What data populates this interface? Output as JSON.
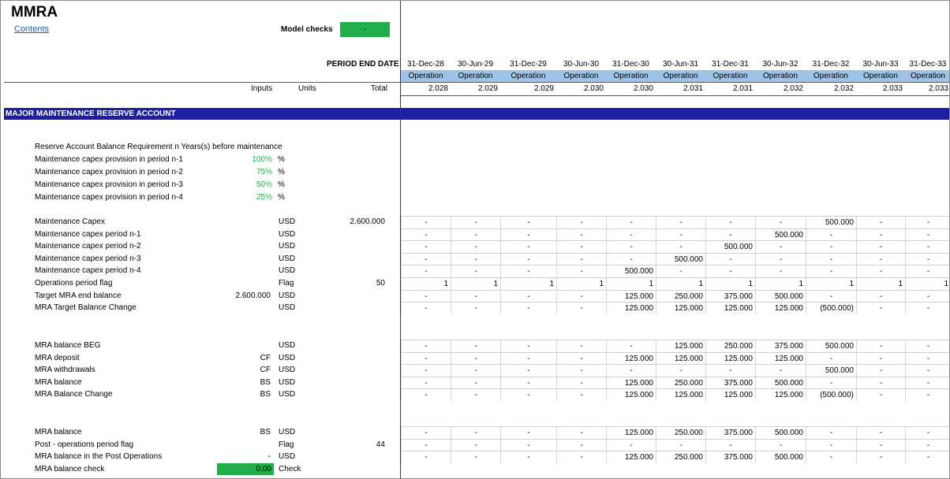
{
  "title": "MMRA",
  "contents_link": "Contents",
  "model_checks": {
    "label": "Model checks",
    "value": "-"
  },
  "period_end_label": "PERIOD END DATE",
  "columns": [
    "31-Dec-28",
    "30-Jun-29",
    "31-Dec-29",
    "30-Jun-30",
    "31-Dec-30",
    "30-Jun-31",
    "31-Dec-31",
    "30-Jun-32",
    "31-Dec-32",
    "30-Jun-33",
    "31-Dec-33"
  ],
  "operation_label": "Operation",
  "years": [
    "2.028",
    "2.029",
    "2.029",
    "2.030",
    "2.030",
    "2.031",
    "2.031",
    "2.032",
    "2.032",
    "2.033",
    "2.033"
  ],
  "header_labels": {
    "inputs": "Inputs",
    "units": "Units",
    "total": "Total"
  },
  "section_title": "MAJOR MAINTENANCE RESERVE ACCOUNT",
  "reserve_header": "Reserve Account Balance Requirement n Years(s) before maintenance",
  "provisions": [
    {
      "label": "Maintenance capex provision in period n-1",
      "value": "100%",
      "unit": "%"
    },
    {
      "label": "Maintenance capex provision in period n-2",
      "value": "75%",
      "unit": "%"
    },
    {
      "label": "Maintenance capex provision in period n-3",
      "value": "50%",
      "unit": "%"
    },
    {
      "label": "Maintenance capex provision in period n-4",
      "value": "25%",
      "unit": "%"
    }
  ],
  "block1": [
    {
      "label": "Maintenance Capex",
      "input": "",
      "unit": "USD",
      "total": "2.600.000",
      "cells": [
        "-",
        "-",
        "-",
        "-",
        "-",
        "-",
        "-",
        "-",
        "500.000",
        "-",
        "-"
      ]
    },
    {
      "label": "Maintenance capex period n-1",
      "input": "",
      "unit": "USD",
      "total": "",
      "cells": [
        "-",
        "-",
        "-",
        "-",
        "-",
        "-",
        "-",
        "500.000",
        "-",
        "-",
        "-"
      ]
    },
    {
      "label": "Maintenance capex period n-2",
      "input": "",
      "unit": "USD",
      "total": "",
      "cells": [
        "-",
        "-",
        "-",
        "-",
        "-",
        "-",
        "500.000",
        "-",
        "-",
        "-",
        "-"
      ]
    },
    {
      "label": "Maintenance capex period n-3",
      "input": "",
      "unit": "USD",
      "total": "",
      "cells": [
        "-",
        "-",
        "-",
        "-",
        "-",
        "500.000",
        "-",
        "-",
        "-",
        "-",
        "-"
      ]
    },
    {
      "label": "Maintenance capex period n-4",
      "input": "",
      "unit": "USD",
      "total": "",
      "cells": [
        "-",
        "-",
        "-",
        "-",
        "500.000",
        "-",
        "-",
        "-",
        "-",
        "-",
        "-"
      ]
    },
    {
      "label": "Operations period flag",
      "input": "",
      "unit": "Flag",
      "total": "50",
      "cells": [
        "1",
        "1",
        "1",
        "1",
        "1",
        "1",
        "1",
        "1",
        "1",
        "1",
        "1"
      ]
    },
    {
      "label": "Target MRA end balance",
      "input": "2.600.000",
      "unit": "USD",
      "total": "",
      "cells": [
        "-",
        "-",
        "-",
        "-",
        "125.000",
        "250.000",
        "375.000",
        "500.000",
        "-",
        "-",
        "-"
      ]
    },
    {
      "label": "MRA Target Balance Change",
      "input": "",
      "unit": "USD",
      "total": "",
      "cells": [
        "-",
        "-",
        "-",
        "-",
        "125.000",
        "125.000",
        "125.000",
        "125.000",
        "(500.000)",
        "-",
        "-"
      ]
    }
  ],
  "block2": [
    {
      "label": "MRA balance BEG",
      "input": "",
      "unit": "USD",
      "total": "",
      "cells": [
        "-",
        "-",
        "-",
        "-",
        "-",
        "125.000",
        "250.000",
        "375.000",
        "500.000",
        "-",
        "-"
      ]
    },
    {
      "label": "MRA deposit",
      "input": "CF",
      "unit": "USD",
      "total": "",
      "cells": [
        "-",
        "-",
        "-",
        "-",
        "125.000",
        "125.000",
        "125.000",
        "125.000",
        "-",
        "-",
        "-"
      ]
    },
    {
      "label": "MRA withdrawals",
      "input": "CF",
      "unit": "USD",
      "total": "",
      "cells": [
        "-",
        "-",
        "-",
        "-",
        "-",
        "-",
        "-",
        "-",
        "500.000",
        "-",
        "-"
      ]
    },
    {
      "label": "MRA balance",
      "input": "BS",
      "unit": "USD",
      "total": "",
      "cells": [
        "-",
        "-",
        "-",
        "-",
        "125.000",
        "250.000",
        "375.000",
        "500.000",
        "-",
        "-",
        "-"
      ]
    },
    {
      "label": "MRA Balance Change",
      "input": "BS",
      "unit": "USD",
      "total": "",
      "cells": [
        "-",
        "-",
        "-",
        "-",
        "125.000",
        "125.000",
        "125.000",
        "125.000",
        "(500.000)",
        "-",
        "-"
      ]
    }
  ],
  "block3": [
    {
      "label": "MRA balance",
      "input": "BS",
      "unit": "USD",
      "total": "",
      "cells": [
        "-",
        "-",
        "-",
        "-",
        "125.000",
        "250.000",
        "375.000",
        "500.000",
        "-",
        "-",
        "-"
      ]
    },
    {
      "label": "Post - operations period flag",
      "input": "",
      "unit": "Flag",
      "total": "44",
      "cells": [
        "-",
        "-",
        "-",
        "-",
        "-",
        "-",
        "-",
        "-",
        "-",
        "-",
        "-"
      ]
    },
    {
      "label": "MRA balance in the Post Operations",
      "input": "-",
      "unit": "USD",
      "total": "",
      "cells": [
        "-",
        "-",
        "-",
        "-",
        "125.000",
        "250.000",
        "375.000",
        "500.000",
        "-",
        "-",
        "-"
      ]
    }
  ],
  "check_row": {
    "label": "MRA balance check",
    "value": "0,00",
    "unit": "Check"
  }
}
